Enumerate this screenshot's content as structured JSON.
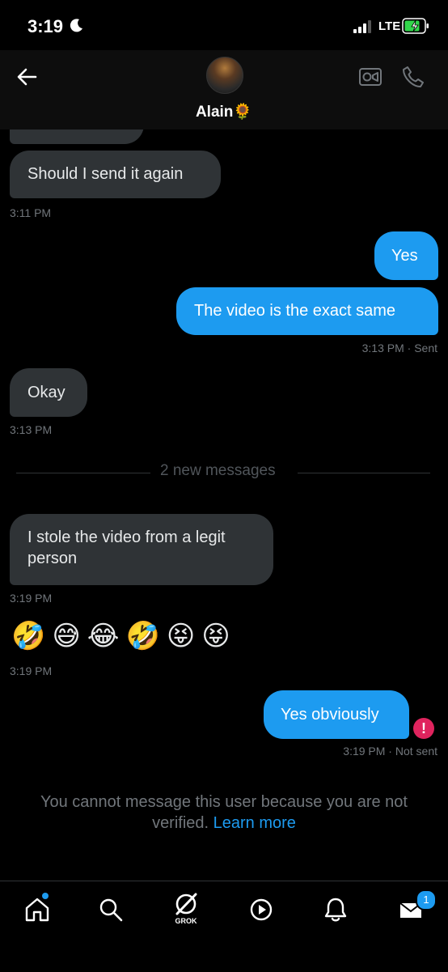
{
  "status": {
    "time": "3:19",
    "network": "LTE"
  },
  "header": {
    "name": "Alain",
    "name_emoji": "🌻"
  },
  "messages": {
    "m1_text": "Should I send it again",
    "m1_time": "3:11 PM",
    "m2_text": "Yes",
    "m3_text": "The video is the exact same",
    "m3_meta": "3:13 PM · Sent",
    "m4_text": "Okay",
    "m4_time": "3:13 PM",
    "divider": "2 new messages",
    "m5_text": "I stole the video from a legit person",
    "m5_time": "3:19 PM",
    "m6_emojis": "🤣😅😂🤣😝😝",
    "m6_time": "3:19 PM",
    "m7_text": "Yes obviously",
    "m7_meta": "3:19 PM · Not sent"
  },
  "notice": {
    "text": "You cannot message this user because you are not verified.",
    "link": "Learn more"
  },
  "tabbar": {
    "grok_label": "GROK",
    "messages_badge": "1"
  },
  "colors": {
    "accent": "#1d9bf0",
    "bubble_in": "#2f3336",
    "error": "#e0245e"
  },
  "icons": [
    "back-arrow-icon",
    "video-call-icon",
    "phone-icon",
    "home-icon",
    "search-icon",
    "grok-icon",
    "play-icon",
    "bell-icon",
    "mail-icon",
    "error-icon"
  ]
}
